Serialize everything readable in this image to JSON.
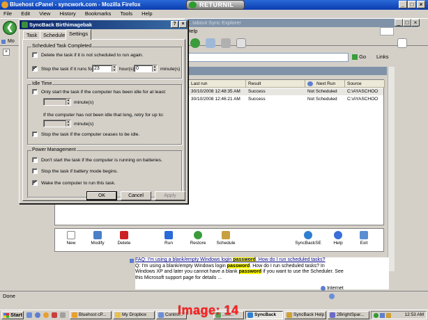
{
  "firefox": {
    "title": "Bluehost cPanel - syncwork.com - Mozilla Firefox",
    "menu": [
      "File",
      "Edit",
      "View",
      "History",
      "Bookmarks",
      "Tools",
      "Help"
    ],
    "tab_label": "Mo",
    "status": "Done"
  },
  "returnil": {
    "label": "RETURNIL"
  },
  "ie": {
    "title": "...tabout Sync Explorer",
    "menu": [
      "Help"
    ],
    "go_label": "Go",
    "links_label": "Links"
  },
  "syncback": {
    "columns": [
      "Last run",
      "Result",
      "Next Run",
      "Source"
    ],
    "rows": [
      {
        "last_run": "30/10/2008 12:48:35 AM",
        "result": "Success",
        "next_run": "Not Scheduled",
        "source": "C:\\AYASCHOO"
      },
      {
        "last_run": "30/10/2008 12:46:21 AM",
        "result": "Success",
        "next_run": "Not Scheduled",
        "source": "C:\\AYASCHOO"
      }
    ],
    "toolbar": [
      "New",
      "Modify",
      "Delete",
      "Run",
      "Restore",
      "Schedule",
      "SyncBackSE",
      "Help",
      "Exit"
    ]
  },
  "search_result": {
    "question_pre": "FAQ: I'm using a blank/empty Windows login ",
    "question_hl": "password",
    "question_post": ". How do I run scheduled tasks?",
    "line2_pre": "Q: I'm using a blank/empty Windows login ",
    "line2_hl": "password",
    "line2_post": ". How do I run scheduled tasks? In",
    "line3_pre": "Windows XP and later you cannot have a blank ",
    "line3_hl": "password",
    "line3_post": " if you want to use the Scheduler. See",
    "line4": "this Microsoft support page for details ..."
  },
  "ie_status": {
    "zone": "Internet"
  },
  "dialog": {
    "title": "SyncBack Birthimagebak",
    "tabs": [
      "Task",
      "Schedule",
      "Settings"
    ],
    "completed": {
      "label": "Scheduled Task Completed",
      "delete_label": "Delete the task if it is not scheduled to run again.",
      "delete_checked": false,
      "stop_label": "Stop the task if it runs for:",
      "stop_checked": true,
      "hours": "23",
      "hours_label": "hour(s)",
      "minutes": "0",
      "minutes_label": "minute(s)"
    },
    "idle": {
      "label": "Idle Time",
      "start_label": "Only start the task if the computer has been idle for at least:",
      "start_checked": false,
      "minutes1_label": "minute(s)",
      "retry_label": "If the computer has not been idle that long, retry for up to:",
      "minutes2_label": "minute(s)",
      "stop_label": "Stop the task if the computer ceases to be idle.",
      "stop_checked": false
    },
    "power": {
      "label": "Power Management",
      "batteries_label": "Don't start the task if the computer is running on batteries.",
      "batteries_checked": false,
      "battery_mode_label": "Stop the task if battery mode begins.",
      "battery_mode_checked": false,
      "wake_label": "Wake the computer to run this task.",
      "wake_checked": true
    },
    "buttons": {
      "ok": "OK",
      "cancel": "Cancel",
      "apply": "Apply"
    }
  },
  "taskbar": {
    "start": "Start",
    "tasks": [
      {
        "label": "Bluehost cP...",
        "color": "#e8a030"
      },
      {
        "label": "My Dropbox",
        "color": "#e8c050"
      },
      {
        "label": "Contro...",
        "color": "#6a8ed8"
      },
      {
        "label": "...m...",
        "color": "#5e9e5e"
      },
      {
        "label": "SyncBack",
        "color": "#2e7fd0",
        "active": true
      },
      {
        "label": "SyncBack Help",
        "color": "#d0a030"
      },
      {
        "label": "2BrightSpar...",
        "color": "#6a6ac8"
      }
    ],
    "clock": "12:53 AM"
  },
  "watermark": "Image: 14",
  "colors": {
    "dialog_title": "#0a246a",
    "highlight": "#ffff00",
    "watermark": "#ff2222"
  }
}
